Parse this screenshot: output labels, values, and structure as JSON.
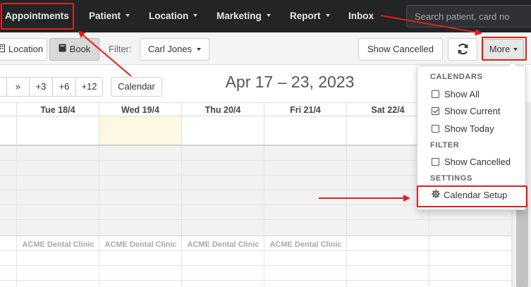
{
  "nav": {
    "items": [
      {
        "label": "Appointments",
        "has_caret": false
      },
      {
        "label": "Patient",
        "has_caret": true
      },
      {
        "label": "Location",
        "has_caret": true
      },
      {
        "label": "Marketing",
        "has_caret": true
      },
      {
        "label": "Report",
        "has_caret": true
      },
      {
        "label": "Inbox",
        "has_caret": false
      }
    ],
    "search_placeholder": "Search patient, card no"
  },
  "toolbar": {
    "location_label": "Location",
    "book_label": "Book",
    "filter_label": "Filter:",
    "filter_value": "Carl Jones",
    "show_cancelled_label": "Show Cancelled",
    "more_label": "More"
  },
  "calendar_nav": {
    "buttons": [
      "»",
      "+3",
      "+6",
      "+12"
    ],
    "calendar_label": "Calendar",
    "range_title": "Apr 17 – 23, 2023"
  },
  "calendar": {
    "days": [
      "Tue 18/4",
      "Wed 19/4",
      "Thu 20/4",
      "Fri 21/4",
      "Sat 22/4"
    ],
    "today_index": 1,
    "clinic_labels": [
      "ACME Dental Clinic",
      "ACME Dental Clinic",
      "ACME Dental Clinic",
      "ACME Dental Clinic"
    ]
  },
  "dropdown": {
    "calendars_header": "CALENDARS",
    "show_all": "Show All",
    "show_current": "Show Current",
    "show_today": "Show Today",
    "filter_header": "FILTER",
    "show_cancelled": "Show Cancelled",
    "settings_header": "SETTINGS",
    "calendar_setup": "Calendar Setup",
    "checked": {
      "show_all": false,
      "show_current": true,
      "show_today": false,
      "show_cancelled": false
    }
  },
  "colors": {
    "navbar_bg": "#222426",
    "highlight": "#e0201b",
    "today_bg": "#fcf8e3"
  }
}
